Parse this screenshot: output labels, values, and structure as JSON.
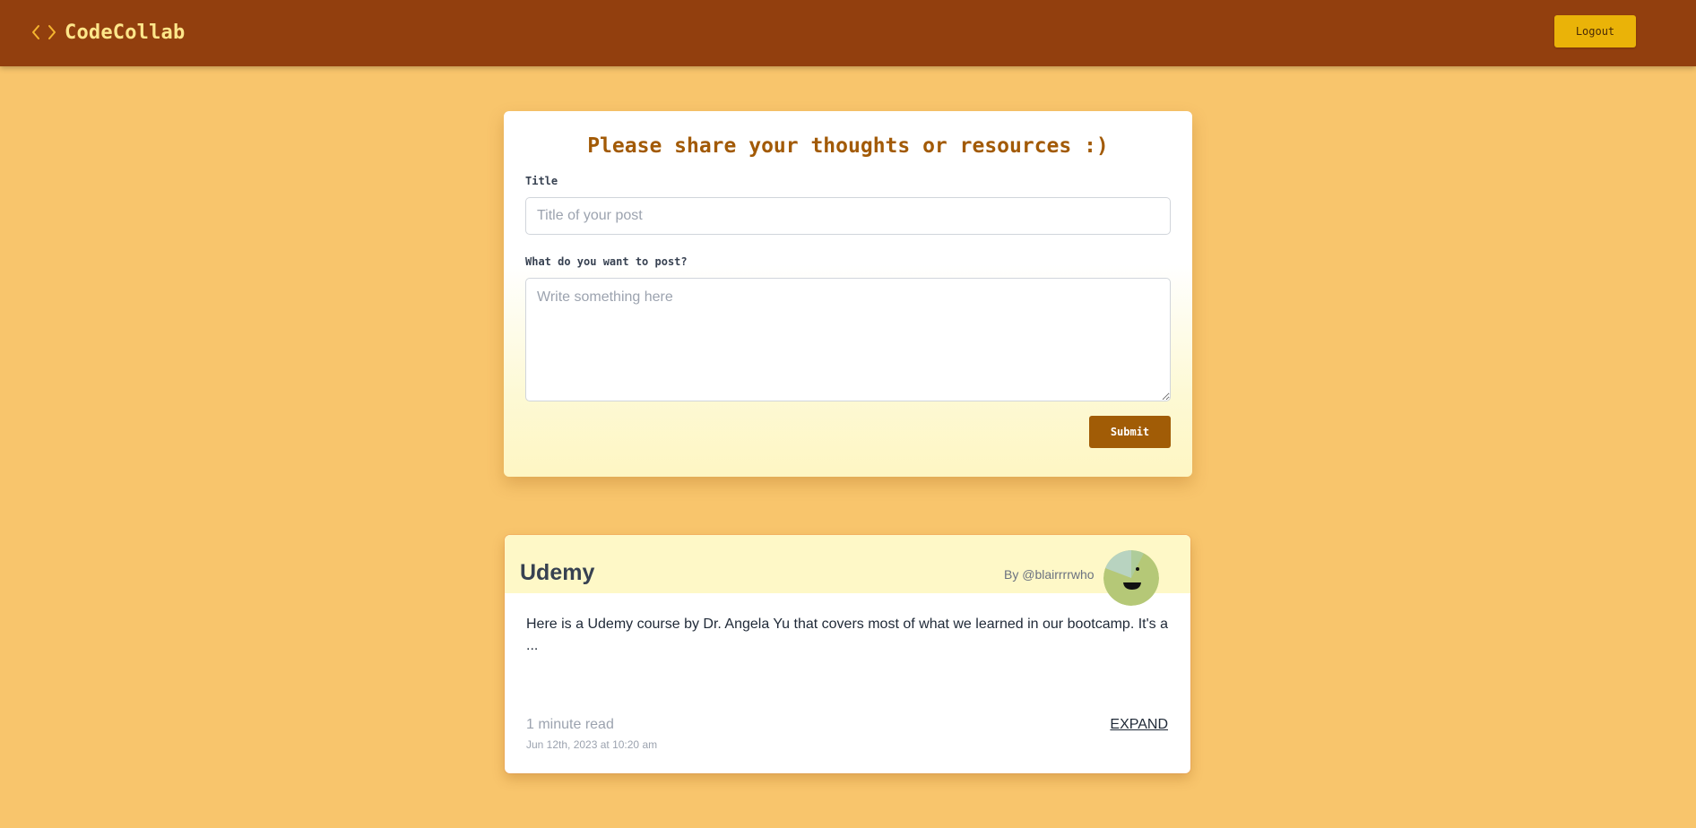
{
  "navbar": {
    "brand": "CodeCollab",
    "brand_icon": "code-brackets-icon",
    "logout_label": "Logout"
  },
  "form": {
    "heading": "Please share your thoughts or resources :)",
    "title_label": "Title",
    "title_placeholder": "Title of your post",
    "title_value": "",
    "body_label": "What do you want to post?",
    "body_placeholder": "Write something here",
    "body_value": "",
    "submit_label": "Submit"
  },
  "posts": [
    {
      "title": "Udemy",
      "author": "By @blairrrrwho",
      "avatar_icon": "smiley-avatar-icon",
      "excerpt": "Here is a Udemy course by Dr. Angela Yu that covers most of what we learned in our bootcamp. It's a ...",
      "read_time": "1 minute read",
      "date": "Jun 12th, 2023 at 10:20 am",
      "expand_label": "EXPAND"
    }
  ],
  "colors": {
    "background": "#f8c56c",
    "navbar": "#923f0e",
    "brand_text": "#fde68a",
    "logout_button": "#eab308",
    "heading": "#a25a06",
    "submit_button": "#a15c06",
    "post_header": "#fef8c7"
  }
}
